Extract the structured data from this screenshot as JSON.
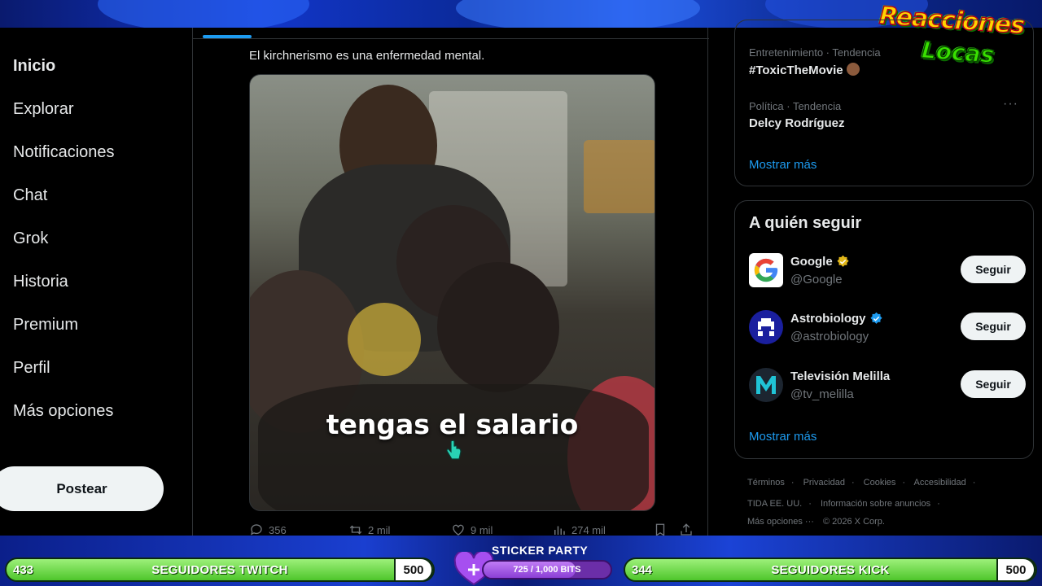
{
  "nav": {
    "items": [
      "Inicio",
      "Explorar",
      "Notificaciones",
      "Chat",
      "Grok",
      "Historia",
      "Premium",
      "Perfil",
      "Más opciones"
    ],
    "post_label": "Postear"
  },
  "tweet": {
    "text": "El kirchnerismo es una enfermedad mental.",
    "caption": "tengas el salario",
    "replies": "356",
    "reposts": "2 mil",
    "likes": "9 mil",
    "views": "274 mil"
  },
  "trends": {
    "items": [
      {
        "meta": "Entretenimiento · Tendencia",
        "name": "#ToxicTheMovie"
      },
      {
        "meta": "Política · Tendencia",
        "name": "Delcy Rodríguez"
      }
    ],
    "show_more": "Mostrar más"
  },
  "who_to_follow": {
    "title": "A quién seguir",
    "accounts": [
      {
        "name": "Google",
        "handle": "@Google",
        "verified": "gold",
        "follow_label": "Seguir"
      },
      {
        "name": "Astrobiology",
        "handle": "@astrobiology",
        "verified": "blue",
        "follow_label": "Seguir"
      },
      {
        "name": "Televisión Melilla",
        "handle": "@tv_melilla",
        "verified": "none",
        "follow_label": "Seguir"
      }
    ],
    "show_more": "Mostrar más"
  },
  "footer": {
    "row1": [
      "Términos",
      "Privacidad",
      "Cookies",
      "Accesibilidad"
    ],
    "row2": [
      "TIDA EE. UU.",
      "Información sobre anuncios"
    ],
    "more": "Más opciones ···",
    "copyright": "© 2026 X Corp."
  },
  "overlay": {
    "logo_line1": "Reacciones",
    "logo_line2": "Locas",
    "twitch": {
      "current": "433",
      "label": "SEGUIDORES TWITCH",
      "goal": "500",
      "progress": 0.866
    },
    "kick": {
      "current": "344",
      "label": "SEGUIDORES KICK",
      "goal": "500",
      "progress": 0.688
    },
    "sticker": {
      "title": "STICKER PARTY",
      "progress_text": "725 / 1,000 BITS",
      "progress": 0.725
    }
  },
  "colors": {
    "accent": "#1d9bf0",
    "bg": "#000000",
    "bar_green": "#4ec62b",
    "sticker_purple": "#8b3fd6"
  }
}
